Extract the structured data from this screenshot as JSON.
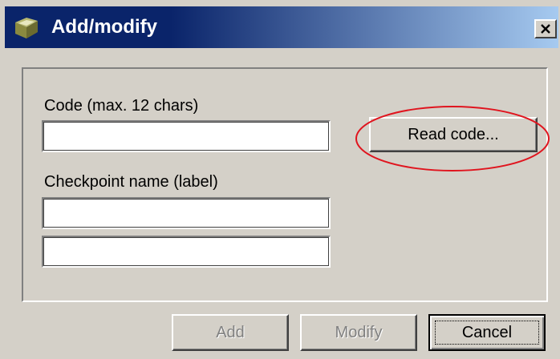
{
  "window": {
    "title": "Add/modify",
    "title_icon": "checkpoint-book-icon",
    "close_icon": "close-icon"
  },
  "form": {
    "code_label": "Code (max. 12 chars)",
    "code_value": "",
    "read_code_label": "Read code...",
    "name_label": "Checkpoint name (label)",
    "name_line1_value": "",
    "name_line2_value": ""
  },
  "buttons": {
    "add_label": "Add",
    "modify_label": "Modify",
    "cancel_label": "Cancel"
  },
  "colors": {
    "title_bar_start": "#0a246a",
    "title_bar_end": "#a6caf0",
    "face": "#d4d0c8",
    "annotation": "#e0141e"
  }
}
